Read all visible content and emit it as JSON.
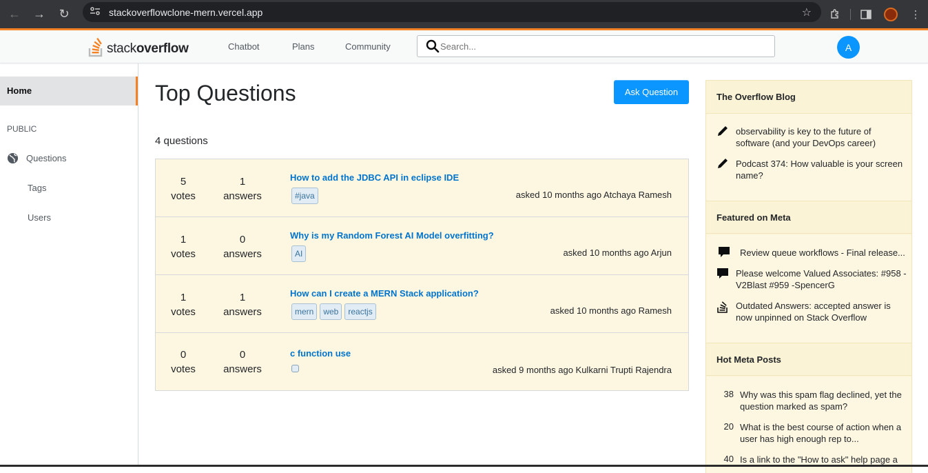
{
  "browser": {
    "url": "stackoverflowclone-mern.vercel.app"
  },
  "navbar": {
    "logo_light": "stack",
    "logo_bold": "overflow",
    "links": [
      "Chatbot",
      "Plans",
      "Community"
    ],
    "search_placeholder": "Search...",
    "avatar_letter": "A"
  },
  "sidebar": {
    "home": "Home",
    "public": "PUBLIC",
    "questions": "Questions",
    "tags": "Tags",
    "users": "Users"
  },
  "main": {
    "title": "Top Questions",
    "ask_button": "Ask Question",
    "count": "4 questions",
    "questions": [
      {
        "votes": "5",
        "votes_label": "votes",
        "answers": "1",
        "answers_label": "answers",
        "title": "How to add the JDBC API in eclipse IDE",
        "tags": [
          "#java"
        ],
        "asked": "asked 10 months ago Atchaya Ramesh"
      },
      {
        "votes": "1",
        "votes_label": "votes",
        "answers": "0",
        "answers_label": "answers",
        "title": "Why is my Random Forest AI Model overfitting?",
        "tags": [
          "AI"
        ],
        "asked": "asked 10 months ago Arjun"
      },
      {
        "votes": "1",
        "votes_label": "votes",
        "answers": "1",
        "answers_label": "answers",
        "title": "How can I create a MERN Stack application?",
        "tags": [
          "mern",
          "web",
          "reactjs"
        ],
        "asked": "asked 10 months ago Ramesh"
      },
      {
        "votes": "0",
        "votes_label": "votes",
        "answers": "0",
        "answers_label": "answers",
        "title": "c function use",
        "tags": [
          ""
        ],
        "asked": "asked 9 months ago Kulkarni Trupti Rajendra"
      }
    ]
  },
  "right_sidebar": {
    "blog_title": "The Overflow Blog",
    "blog_items": [
      {
        "icon": "pencil-icon",
        "line1": "observability is key to the future of",
        "line2": "software (and your DevOps career)"
      },
      {
        "icon": "pencil-icon",
        "line1": "Podcast 374: How valuable is your screen",
        "line2": "name?"
      }
    ],
    "meta_title": "Featured on Meta",
    "meta_items": [
      {
        "icon": "comment-icon",
        "line1": "Review queue workflows - Final release...",
        "line2": ""
      },
      {
        "icon": "comment-icon",
        "line1": "Please welcome Valued Associates: #958 -",
        "line2": "V2Blast #959 -SpencerG"
      },
      {
        "icon": "stack-icon",
        "line1": "Outdated Answers: accepted answer is",
        "line2": "now unpinned on Stack Overflow"
      }
    ],
    "hot_title": "Hot Meta Posts",
    "hot_items": [
      {
        "count": "38",
        "line1": "Why was this spam flag declined, yet the",
        "line2": "question marked as spam?"
      },
      {
        "count": "20",
        "line1": "What is the best course of action when a",
        "line2": "user has high enough rep to..."
      },
      {
        "count": "40",
        "line1": "Is a link to the \"How to ask\" help page a",
        "line2": ""
      }
    ]
  }
}
